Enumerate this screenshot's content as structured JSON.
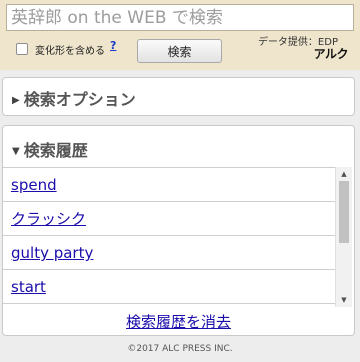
{
  "search": {
    "placeholder": "英辞郎 on the WEB で検索",
    "value": "",
    "button_label": "検索",
    "checkbox_label": "変化形を含める",
    "help_label": "?"
  },
  "header": {
    "data_credit": "データ提供：EDP",
    "logo": "アルク"
  },
  "options_panel": {
    "title": "検索オプション",
    "icon": "triangle-right-icon"
  },
  "history_panel": {
    "title": "検索履歴",
    "icon": "triangle-down-icon",
    "items": [
      "spend",
      "クラッシク",
      "gulty party",
      "start"
    ],
    "clear_label": "検索履歴を消去"
  },
  "footer": {
    "copyright": "©2017 ALC PRESS INC."
  }
}
